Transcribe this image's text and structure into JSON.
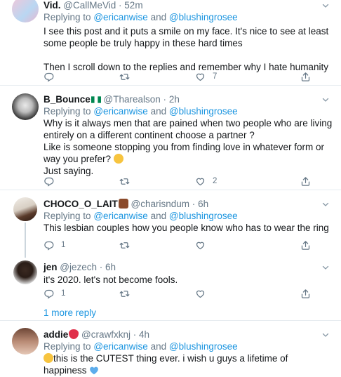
{
  "tweets": [
    {
      "name": "Vid.",
      "handle": "@CallMeVid",
      "time": "52m",
      "replying_label": "Replying to",
      "mention1": "@ericanwise",
      "and_label": "and",
      "mention2": "@blushingrosee",
      "text": "I see this post and it puts a smile on my face. It's nice to see at least some people be truly happy in these hard times\n\nThen I scroll down to the replies and remember why I hate humanity",
      "likes": "7"
    },
    {
      "name": "B_Bounce",
      "handle": "@Tharealson",
      "time": "2h",
      "replying_label": "Replying to",
      "mention1": "@ericanwise",
      "and_label": "and",
      "mention2": "@blushingrosee",
      "text": "Why is it always men that are pained when two people who are living entirely on a different continent choose a partner ?\nLike is someone stopping you from finding love in whatever form or way you prefer?",
      "text2": "Just saying.",
      "likes": "2"
    },
    {
      "name": "CHOCO_O_LAIT",
      "handle": "@charisndum",
      "time": "6h",
      "replying_label": "Replying to",
      "mention1": "@ericanwise",
      "and_label": "and",
      "mention2": "@blushingrosee",
      "text": "This lesbian couples how you people know who has to wear the ring",
      "replies": "1"
    },
    {
      "name": "jen",
      "handle": "@jezech",
      "time": "6h",
      "text": "it's 2020. let's not become fools.",
      "replies": "1"
    },
    {
      "name": "addie",
      "handle": "@crawfxknj",
      "time": "4h",
      "replying_label": "Replying to",
      "mention1": "@ericanwise",
      "and_label": "and",
      "mention2": "@blushingrosee",
      "text": "this is the CUTEST thing ever. i wish u guys a lifetime of happiness"
    }
  ],
  "more_replies": "1 more reply",
  "dot": "·",
  "colors": {
    "link": "#1b95e0",
    "muted": "#657786",
    "border": "#e6ecf0"
  }
}
